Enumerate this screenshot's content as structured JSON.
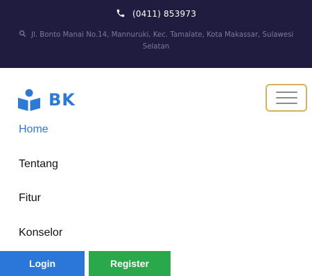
{
  "topbar": {
    "phone": "(0411) 853973",
    "address": "Jl. Bonto Manai No.14, Mannuruki, Kec. Tamalate, Kota Makassar, Sulawesi Selatan"
  },
  "brand": {
    "name": "BK"
  },
  "nav": {
    "items": [
      {
        "label": "Home",
        "active": true
      },
      {
        "label": "Tentang",
        "active": false
      },
      {
        "label": "Fitur",
        "active": false
      },
      {
        "label": "Konselor",
        "active": false
      }
    ]
  },
  "auth": {
    "login_label": "Login",
    "register_label": "Register"
  },
  "colors": {
    "topbar_bg": "#1f1c3f",
    "accent_blue": "#2c7ad6",
    "login_bg": "#2b77d9",
    "register_bg": "#2aa84c",
    "toggler_border": "#d6b25d"
  },
  "icons": {
    "phone": "phone-icon",
    "location": "location-icon",
    "logo": "reader-logo-icon",
    "menu": "hamburger-icon"
  }
}
